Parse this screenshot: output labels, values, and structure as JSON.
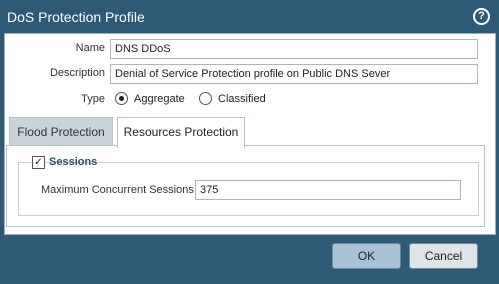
{
  "dialog": {
    "title": "DoS Protection Profile",
    "help_icon": "question-mark-icon"
  },
  "form": {
    "name_label": "Name",
    "name_value": "DNS DDoS",
    "description_label": "Description",
    "description_value": "Denial of Service Protection profile on Public DNS Sever",
    "type_label": "Type",
    "type_options": [
      "Aggregate",
      "Classified"
    ],
    "type_selected": "Aggregate"
  },
  "tabs": [
    {
      "label": "Flood Protection",
      "active": false
    },
    {
      "label": "Resources Protection",
      "active": true
    }
  ],
  "resources": {
    "sessions_label": "Sessions",
    "sessions_checked": true,
    "max_sessions_label": "Maximum Concurrent Sessions",
    "max_sessions_value": "375"
  },
  "buttons": {
    "ok": "OK",
    "cancel": "Cancel"
  },
  "colors": {
    "title_bar": "#2e5a76",
    "ok_button": "#a9c1d2",
    "inactive_tab": "#c9d3da"
  }
}
